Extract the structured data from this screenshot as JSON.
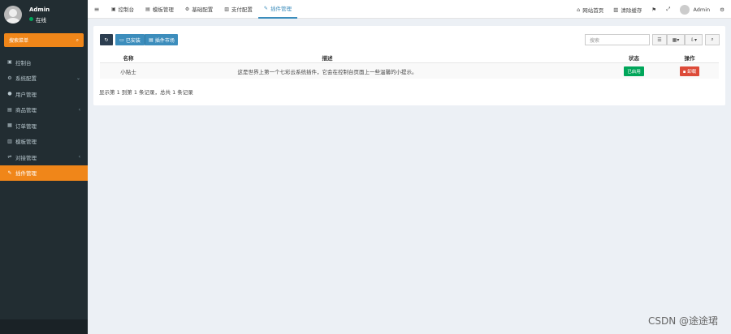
{
  "sidebar": {
    "user": {
      "name": "Admin",
      "status": "在线"
    },
    "search": {
      "placeholder": "搜索菜单"
    },
    "items": [
      {
        "label": "控制台",
        "icon": "dashboard-icon",
        "glyph": "▣",
        "has_arrow": false
      },
      {
        "label": "系统配置",
        "icon": "gear-icon",
        "glyph": "⚙",
        "has_arrow": true,
        "arrow": "⌄"
      },
      {
        "label": "用户管理",
        "icon": "user-icon",
        "glyph": "●",
        "has_arrow": false
      },
      {
        "label": "商品管理",
        "icon": "box-icon",
        "glyph": "▤",
        "has_arrow": true,
        "arrow": "‹"
      },
      {
        "label": "订单管理",
        "icon": "cart-icon",
        "glyph": "▦",
        "has_arrow": false
      },
      {
        "label": "模板管理",
        "icon": "template-icon",
        "glyph": "▥",
        "has_arrow": false
      },
      {
        "label": "对接管理",
        "icon": "link-icon",
        "glyph": "⇌",
        "has_arrow": true,
        "arrow": "‹"
      },
      {
        "label": "插件管理",
        "icon": "plugin-icon",
        "glyph": "✎",
        "has_arrow": false,
        "active": true
      }
    ]
  },
  "topnav": {
    "menu_glyph": "≡",
    "tabs": [
      {
        "label": "控制台",
        "icon": "dashboard-icon",
        "glyph": "▣"
      },
      {
        "label": "模板管理",
        "icon": "template-icon",
        "glyph": "▤"
      },
      {
        "label": "基础配置",
        "icon": "gear-icon",
        "glyph": "⚙"
      },
      {
        "label": "支付配置",
        "icon": "payment-icon",
        "glyph": "▥"
      },
      {
        "label": "插件管理",
        "icon": "plugin-icon",
        "glyph": "✎",
        "active": true
      }
    ],
    "right": {
      "site_home": "网站首页",
      "clear_cache": "清除缓存",
      "admin_name": "Admin"
    }
  },
  "toolbar": {
    "refresh_glyph": "↻",
    "installed_label": "已安装",
    "market_label": "插件市场",
    "search_placeholder": "搜索"
  },
  "table": {
    "headers": {
      "name": "名称",
      "desc": "描述",
      "status": "状态",
      "ops": "操作"
    },
    "rows": [
      {
        "name": "小贴士",
        "desc": "这是世界上第一个七彩云系统插件，它会在控制台页面上一些温馨的小提示。",
        "status": "已启用",
        "op": "卸载"
      }
    ]
  },
  "pagination_info": "显示第 1 到第 1 条记录，总共 1 条记录",
  "watermark": "CSDN @途途珺"
}
